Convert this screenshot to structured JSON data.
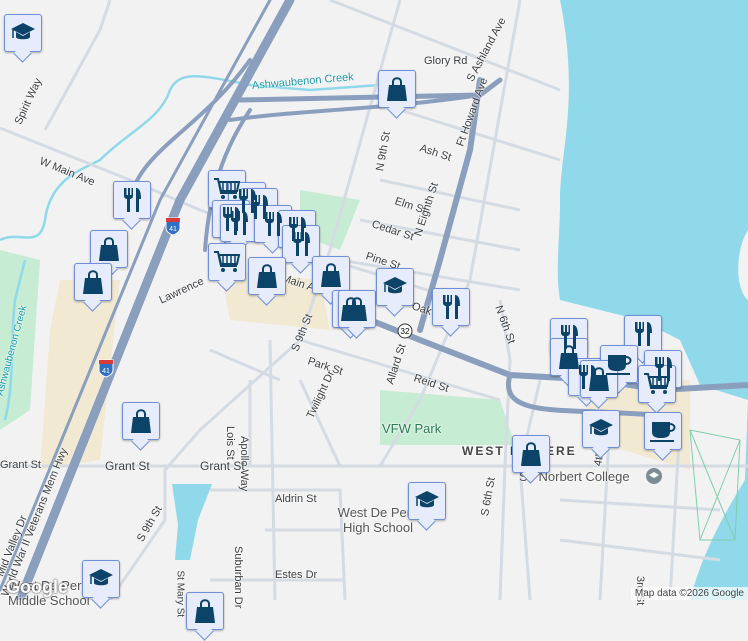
{
  "map": {
    "colors": {
      "water": "#8fd9ea",
      "park": "#c6ecd3",
      "highway": "#8a9fbe",
      "road": "#d5dbe3",
      "marker_bg": "#e6ecfb",
      "marker_icon": "#0b4468"
    },
    "road_labels": [
      "Glory Rd",
      "S Ashland Ave",
      "Ash St",
      "N 9th St",
      "Ft Howard Ave",
      "Elm St",
      "Cedar St",
      "N Eighth St",
      "Pine St",
      "Oak St",
      "N 6th St",
      "Spirit Way",
      "W Main Ave",
      "Mid Valley Dr",
      "Lawrence",
      "Main Ave",
      "S 9th St",
      "Park St",
      "Allard St",
      "Reid St",
      "Twilight Dr",
      "Lois St",
      "Apollo Way",
      "Grant St",
      "Grant St",
      "Grant St",
      "S 6th St",
      "4th St",
      "Aldrin St",
      "Suburban Dr",
      "St Mary St",
      "Estes Dr",
      "World War II Veterans Mem Hwy",
      "3rd St",
      "S 9th St"
    ],
    "water_labels": [
      "Ashwaubenon Creek",
      "Ashwaubenon Creek"
    ],
    "place_labels": {
      "park": "VFW Park",
      "district": "WEST DE PERE",
      "college": "St. Norbert College",
      "high_school": "West De Pere High School",
      "middle_school": "West De Pere Middle School"
    },
    "shields": {
      "interstate": "41",
      "state": "32"
    },
    "markers": [
      {
        "type": "school"
      },
      {
        "type": "restaurant"
      },
      {
        "type": "shopping"
      },
      {
        "type": "shopping"
      },
      {
        "type": "grocery"
      },
      {
        "type": "restaurant"
      },
      {
        "type": "restaurant"
      },
      {
        "type": "restaurant"
      },
      {
        "type": "restaurant"
      },
      {
        "type": "restaurant"
      },
      {
        "type": "restaurant"
      },
      {
        "type": "restaurant"
      },
      {
        "type": "grocery"
      },
      {
        "type": "shopping"
      },
      {
        "type": "shopping"
      },
      {
        "type": "shopping"
      },
      {
        "type": "shopping"
      },
      {
        "type": "shopping"
      },
      {
        "type": "school"
      },
      {
        "type": "restaurant"
      },
      {
        "type": "restaurant"
      },
      {
        "type": "shopping"
      },
      {
        "type": "restaurant"
      },
      {
        "type": "restaurant"
      },
      {
        "type": "cafe"
      },
      {
        "type": "restaurant"
      },
      {
        "type": "shopping"
      },
      {
        "type": "grocery"
      },
      {
        "type": "school"
      },
      {
        "type": "cafe"
      },
      {
        "type": "shopping"
      },
      {
        "type": "school"
      },
      {
        "type": "shopping"
      },
      {
        "type": "school"
      },
      {
        "type": "shopping"
      }
    ],
    "attribution": "Map data ©2026 Google",
    "logo": "Google"
  }
}
